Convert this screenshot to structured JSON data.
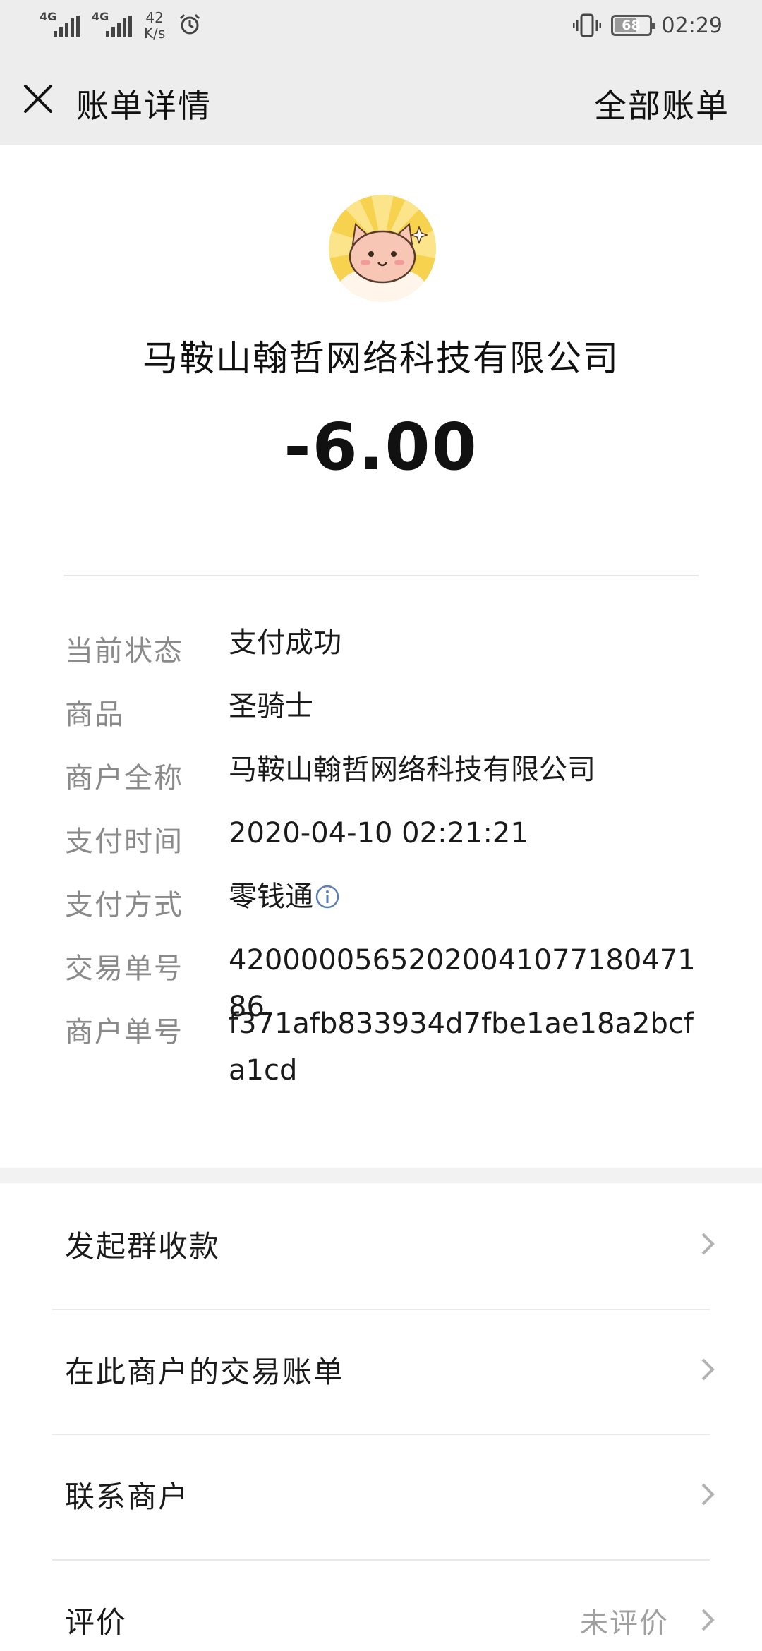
{
  "status_bar": {
    "signal1": "4G",
    "signal2": "4G",
    "speed_value": "42",
    "speed_unit": "K/s",
    "battery": "68",
    "time": "02:29"
  },
  "nav": {
    "title": "账单详情",
    "action": "全部账单"
  },
  "header": {
    "merchant": "马鞍山翰哲网络科技有限公司",
    "amount": "-6.00"
  },
  "details": [
    {
      "label": "当前状态",
      "value": "支付成功"
    },
    {
      "label": "商品",
      "value": "圣骑士"
    },
    {
      "label": "商户全称",
      "value": "马鞍山翰哲网络科技有限公司"
    },
    {
      "label": "支付时间",
      "value": "2020-04-10 02:21:21"
    },
    {
      "label": "支付方式",
      "value": "零钱通"
    },
    {
      "label": "交易单号",
      "value": "4200000565202004107718047186"
    },
    {
      "label": "商户单号",
      "value": "f371afb833934d7fbe1ae18a2bcfa1cd"
    }
  ],
  "menu": [
    {
      "label": "发起群收款",
      "sub": ""
    },
    {
      "label": "在此商户的交易账单",
      "sub": ""
    },
    {
      "label": "联系商户",
      "sub": ""
    },
    {
      "label": "评价",
      "sub": "未评价"
    }
  ],
  "colors": {
    "header_bg": "#ededed",
    "label_gray": "#8a8a8a",
    "info_icon": "#5b7fb5"
  },
  "icons": {
    "close": "close-icon",
    "info": "info-icon",
    "chevron": "chevron-right-icon",
    "alarm": "alarm-icon",
    "vibrate": "vibrate-icon"
  }
}
